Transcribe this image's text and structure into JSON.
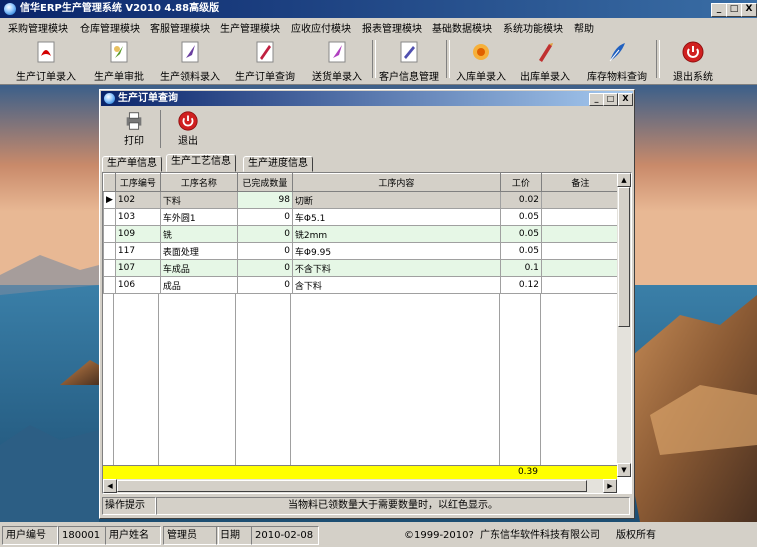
{
  "app": {
    "title": "信华ERP生产管理系统  V2010 4.88高级版",
    "win_min": "_",
    "win_max": "□",
    "win_close": "X"
  },
  "menu": [
    "采购管理模块",
    "仓库管理模块",
    "客服管理模块",
    "生产管理模块",
    "应收应付模块",
    "报表管理模块",
    "基础数据模块",
    "系统功能模块",
    "帮助"
  ],
  "toolbar": [
    {
      "label": "生产订单录入",
      "icon": "pdf-document-icon",
      "color": "#d40000"
    },
    {
      "label": "生产单审批",
      "icon": "leaf-document-icon",
      "color": "#5a9a2a"
    },
    {
      "label": "生产领料录入",
      "icon": "feather-document-icon",
      "color": "#6a3fa0"
    },
    {
      "label": "生产订单查询",
      "icon": "pen-document-icon",
      "color": "#c02040"
    },
    {
      "label": "送货单录入",
      "icon": "feather-document-icon",
      "color": "#b040c0"
    },
    {
      "label": "客户信息管理",
      "icon": "contact-document-icon",
      "color": "#5050b0"
    },
    {
      "label": "入库单录入",
      "icon": "flower-document-icon",
      "color": "#e08000"
    },
    {
      "label": "出库单录入",
      "icon": "pencil-document-icon",
      "color": "#c03030"
    },
    {
      "label": "库存物料查询",
      "icon": "quill-icon",
      "color": "#2060c0"
    },
    {
      "label": "退出系统",
      "icon": "power-icon",
      "color": "#d02020"
    }
  ],
  "child": {
    "title": "生产订单查询",
    "print_label": "打印",
    "exit_label": "退出",
    "tabs": [
      "生产单信息",
      "生产工艺信息",
      "生产进度信息"
    ],
    "active_tab": 1,
    "columns": [
      "工序编号",
      "工序名称",
      "已完成数量",
      "工序内容",
      "工价",
      "备注"
    ],
    "rows": [
      {
        "code": "102",
        "name": "下料",
        "done": "98",
        "content": "切断",
        "price": "0.02",
        "note": ""
      },
      {
        "code": "103",
        "name": "车外圆1",
        "done": "0",
        "content": "车Φ5.1",
        "price": "0.05",
        "note": ""
      },
      {
        "code": "109",
        "name": "铣",
        "done": "0",
        "content": "铣2mm",
        "price": "0.05",
        "note": ""
      },
      {
        "code": "117",
        "name": "表面处理",
        "done": "0",
        "content": "车Φ9.95",
        "price": "0.05",
        "note": ""
      },
      {
        "code": "107",
        "name": "车成品",
        "done": "0",
        "content": "不含下料",
        "price": "0.1",
        "note": ""
      },
      {
        "code": "106",
        "name": "成品",
        "done": "0",
        "content": "含下料",
        "price": "0.12",
        "note": ""
      }
    ],
    "total_price": "0.39",
    "hint_label": "操作提示",
    "hint_text": "当物料已领数量大于需要数量时，以红色显示。"
  },
  "status": {
    "user_id_label": "用户编号",
    "user_id": "180001",
    "user_name_label": "用户姓名",
    "user_name": "管理员",
    "date_label": "日期",
    "date": "2010-02-08",
    "copyright": "©1999-2010?",
    "company": "广东信华软件科技有限公司",
    "rights": "版权所有"
  },
  "colors": {
    "row_alt": "#e6f7e6",
    "sum_row": "#ffff00",
    "title_bar": "#0a246a"
  }
}
